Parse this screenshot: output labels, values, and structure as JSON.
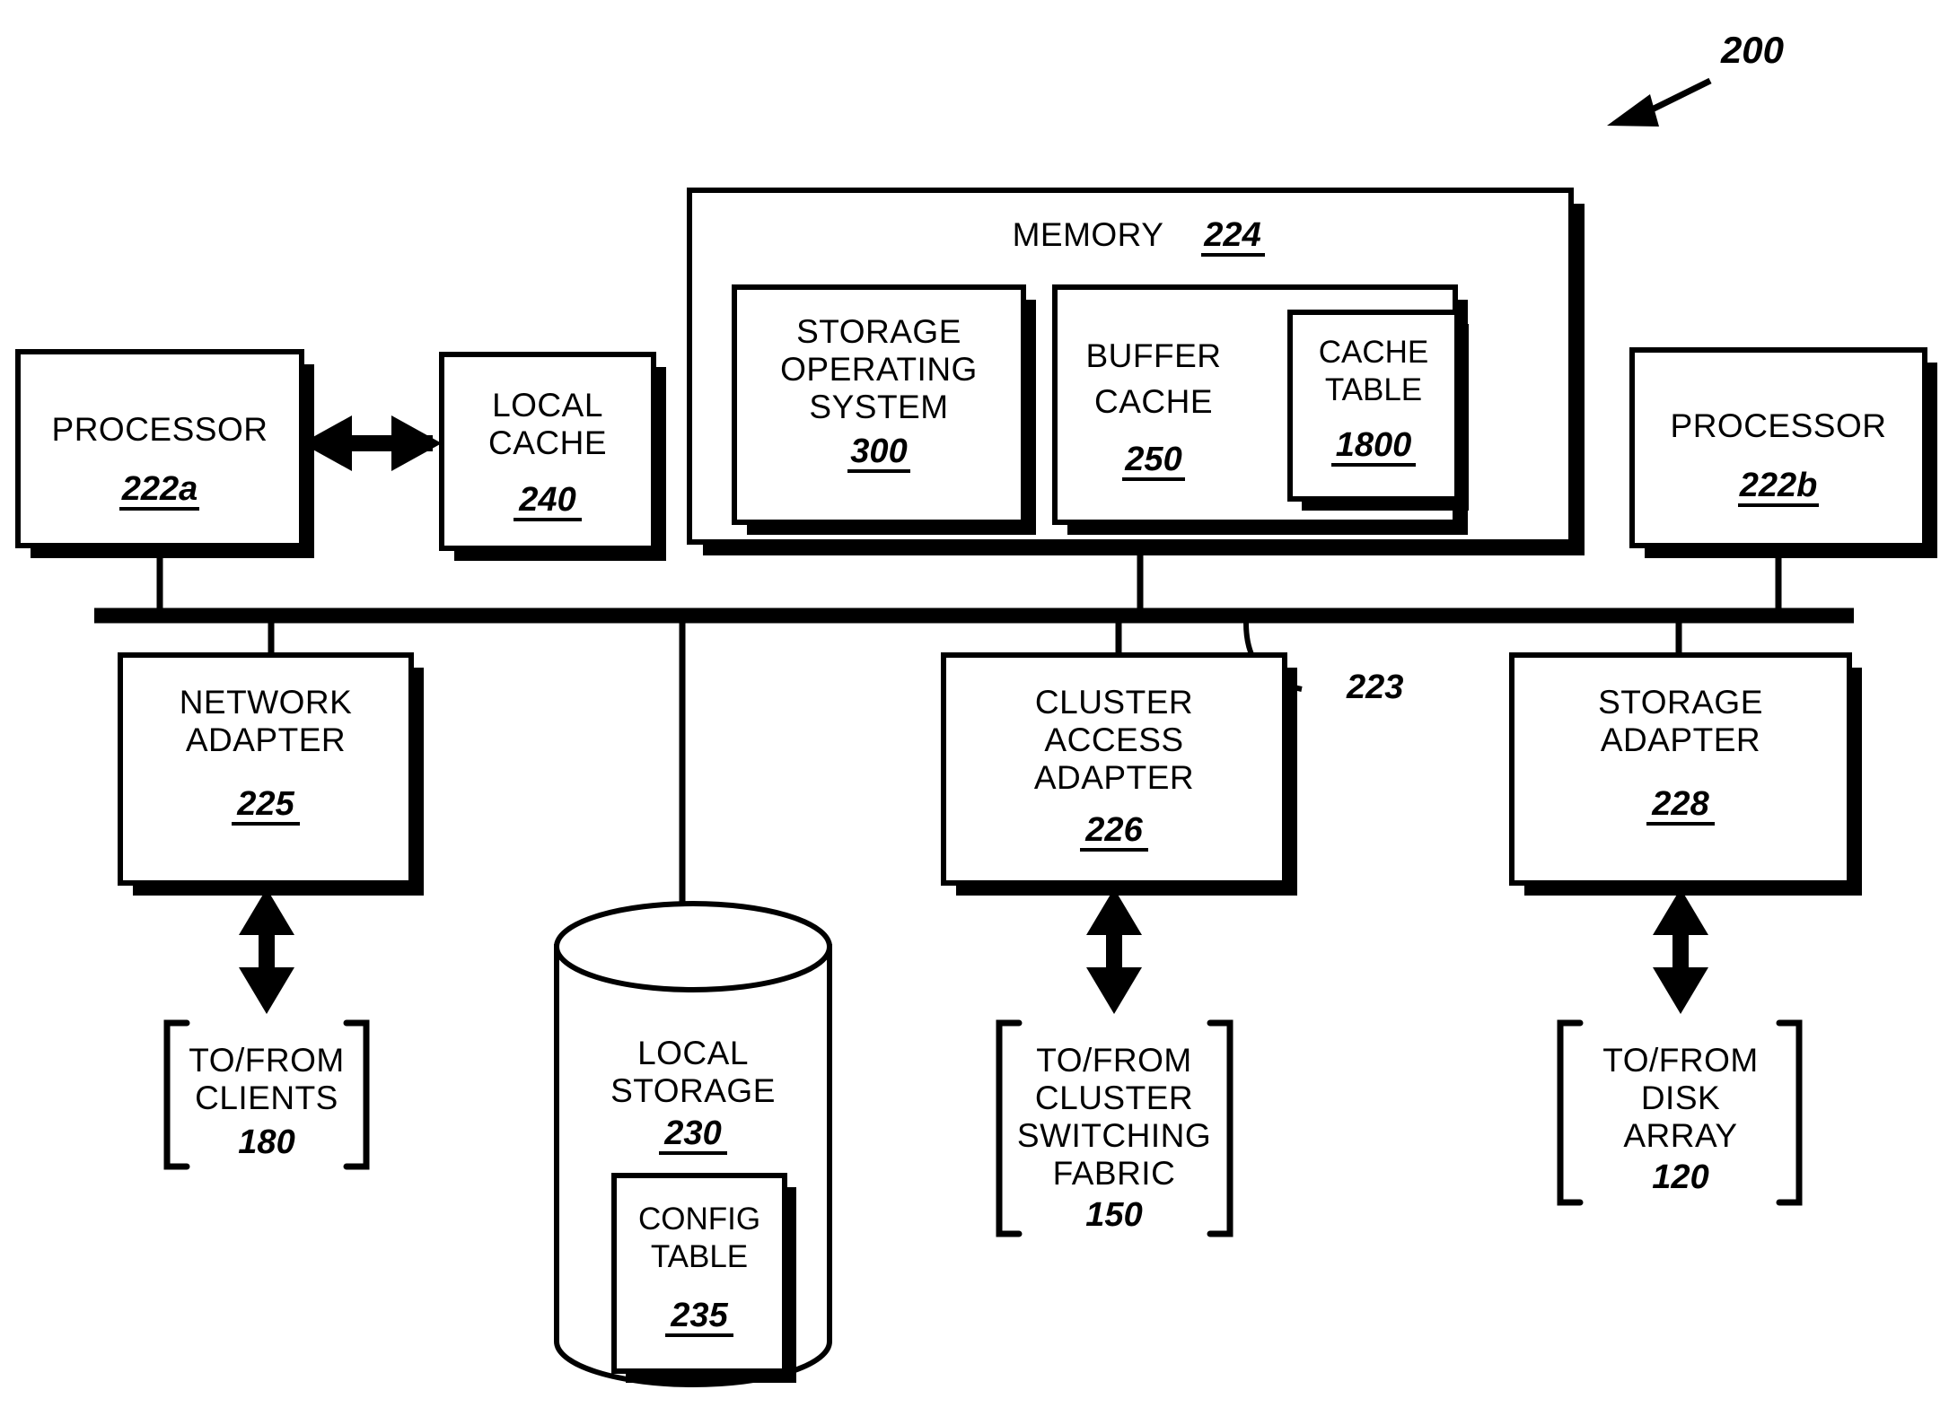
{
  "figure": {
    "reference_numeral": "200",
    "title_annotation": "200"
  },
  "bus": {
    "label": "223"
  },
  "nodes": {
    "processor_a": {
      "label": "PROCESSOR",
      "ref": "222a"
    },
    "local_cache": {
      "line1": "LOCAL",
      "line2": "CACHE",
      "ref": "240"
    },
    "memory": {
      "label": "MEMORY",
      "ref": "224"
    },
    "storage_operating_system": {
      "line1": "STORAGE",
      "line2": "OPERATING",
      "line3": "SYSTEM",
      "ref": "300"
    },
    "buffer_cache": {
      "line1": "BUFFER",
      "line2": "CACHE",
      "ref": "250"
    },
    "cache_table": {
      "line1": "CACHE",
      "line2": "TABLE",
      "ref": "1800"
    },
    "processor_b": {
      "label": "PROCESSOR",
      "ref": "222b"
    },
    "network_adapter": {
      "line1": "NETWORK",
      "line2": "ADAPTER",
      "ref": "225"
    },
    "local_storage": {
      "line1": "LOCAL",
      "line2": "STORAGE",
      "ref": "230"
    },
    "config_table": {
      "line1": "CONFIG",
      "line2": "TABLE",
      "ref": "235"
    },
    "cluster_access_adapter": {
      "line1": "CLUSTER",
      "line2": "ACCESS",
      "line3": "ADAPTER",
      "ref": "226"
    },
    "storage_adapter": {
      "line1": "STORAGE",
      "line2": "ADAPTER",
      "ref": "228"
    }
  },
  "endpoints": {
    "clients": {
      "line1": "TO/FROM",
      "line2": "CLIENTS",
      "ref": "180"
    },
    "cluster_switching_fabric": {
      "line1": "TO/FROM",
      "line2": "CLUSTER",
      "line3": "SWITCHING",
      "line4": "FABRIC",
      "ref": "150"
    },
    "disk_array": {
      "line1": "TO/FROM",
      "line2": "DISK",
      "line3": "ARRAY",
      "ref": "120"
    }
  },
  "colors": {
    "stroke": "#000000",
    "fill": "#ffffff"
  }
}
